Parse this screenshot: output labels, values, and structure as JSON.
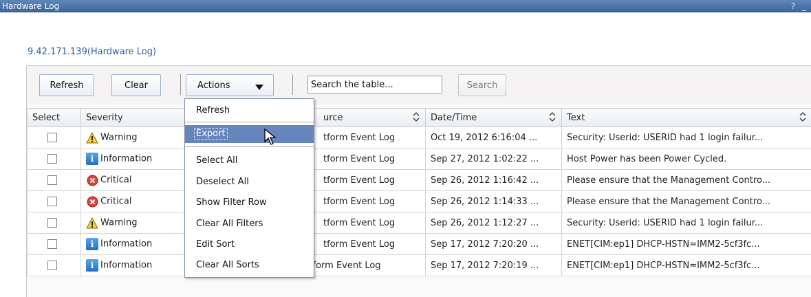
{
  "window": {
    "title": "Hardware Log",
    "controls": "? _"
  },
  "page": {
    "subtitle": "9.42.171.139(Hardware Log)"
  },
  "toolbar": {
    "refresh_label": "Refresh",
    "clear_label": "Clear",
    "actions_label": "Actions",
    "search_placeholder": "Search the table...",
    "search_label": "Search"
  },
  "table": {
    "columns": [
      "Select",
      "Severity",
      "Source",
      "Date/Time",
      "Text"
    ],
    "source_header_visible": "urce",
    "rows": [
      {
        "severity": "Warning",
        "icon": "warning-icon",
        "source": "Platform Event Log",
        "source_visible": "tform Event Log",
        "datetime": "Oct 19, 2012 6:16:04 ...",
        "text": "Security: Userid: USERID had 1 login failur..."
      },
      {
        "severity": "Information",
        "icon": "info-icon",
        "source": "Platform Event Log",
        "source_visible": "tform Event Log",
        "datetime": "Sep 27, 2012 1:02:22 ...",
        "text": "Host Power has been Power Cycled."
      },
      {
        "severity": "Critical",
        "icon": "critical-icon",
        "source": "Platform Event Log",
        "source_visible": "tform Event Log",
        "datetime": "Sep 26, 2012 1:16:42 ...",
        "text": "Please ensure that the Management Contro..."
      },
      {
        "severity": "Critical",
        "icon": "critical-icon",
        "source": "Platform Event Log",
        "source_visible": "tform Event Log",
        "datetime": "Sep 26, 2012 1:14:33 ...",
        "text": "Please ensure that the Management Contro..."
      },
      {
        "severity": "Warning",
        "icon": "warning-icon",
        "source": "Platform Event Log",
        "source_visible": "tform Event Log",
        "datetime": "Sep 26, 2012 1:12:27 ...",
        "text": "Security: Userid: USERID had 1 login failur..."
      },
      {
        "severity": "Information",
        "icon": "info-icon",
        "source": "Platform Event Log",
        "source_visible": "tform Event Log",
        "datetime": "Sep 17, 2012 7:20:20 ...",
        "text": "ENET[CIM:ep1] DHCP-HSTN=IMM2-5cf3fc..."
      },
      {
        "severity": "Information",
        "icon": "info-icon",
        "source": "Platform Event Log",
        "source_visible": "Platform Event Log",
        "datetime": "Sep 17, 2012 7:20:19 ...",
        "text": "ENET[CIM:ep1] DHCP-HSTN=IMM2-5cf3fc..."
      }
    ]
  },
  "actions_menu": {
    "items": [
      "Refresh",
      "Export",
      "Select All",
      "Deselect All",
      "Show Filter Row",
      "Clear All Filters",
      "Edit Sort",
      "Clear All Sorts"
    ],
    "selected": "Export"
  },
  "colors": {
    "titlebar": "#4a73a8",
    "link": "#2d5fa0",
    "menu_highlight": "#6685bd"
  }
}
